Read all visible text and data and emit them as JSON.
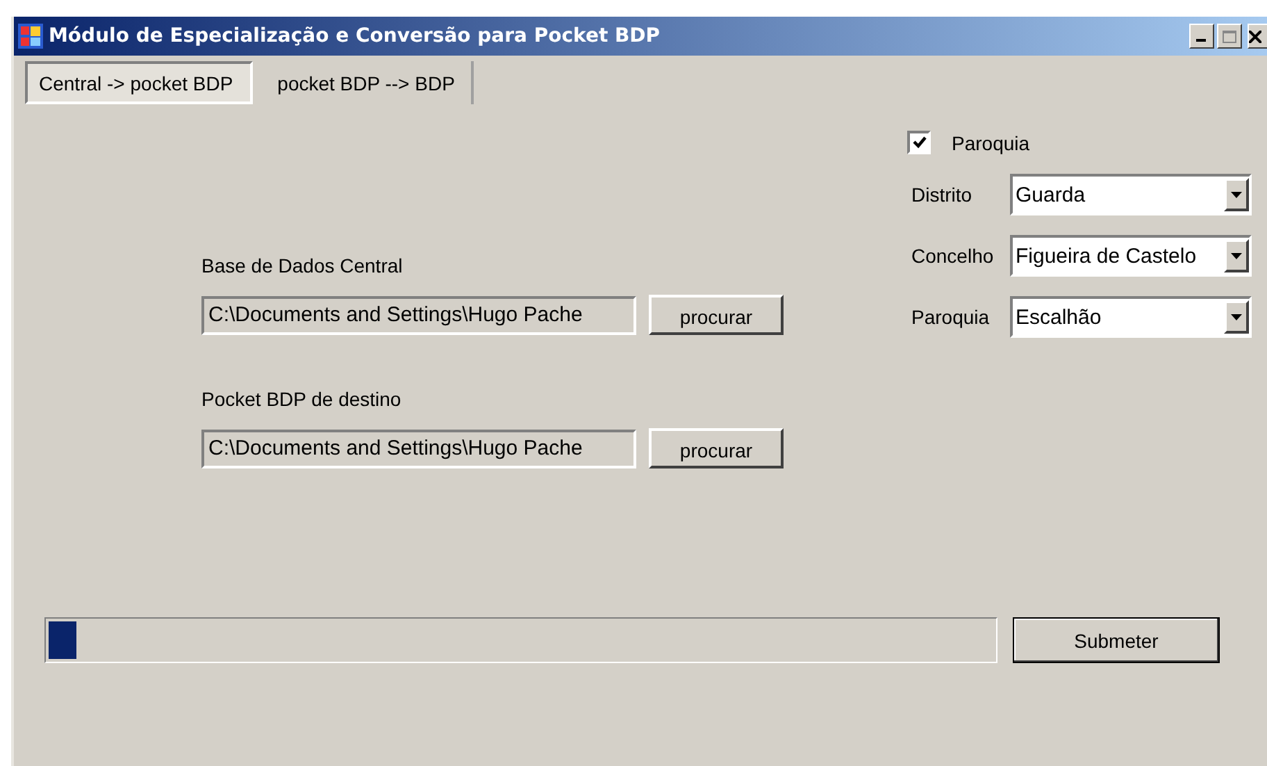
{
  "window": {
    "title": "Módulo de Especialização e Conversão para Pocket BDP"
  },
  "tabs": [
    {
      "label": "Central -> pocket BDP",
      "selected": true
    },
    {
      "label": "pocket BDP --> BDP",
      "selected": false
    }
  ],
  "files": [
    {
      "label": "Base de Dados Central",
      "value": "C:\\Documents and Settings\\Hugo Pache",
      "button": "procurar"
    },
    {
      "label": "Pocket BDP de destino",
      "value": "C:\\Documents and Settings\\Hugo Pache",
      "button": "procurar"
    }
  ],
  "filter": {
    "checkbox": {
      "label": "Paroquia",
      "checked": true
    },
    "combos": [
      {
        "label": "Distrito",
        "value": "Guarda"
      },
      {
        "label": "Concelho",
        "value": "Figueira de Castelo"
      },
      {
        "label": "Paroquia",
        "value": "Escalhão"
      }
    ]
  },
  "progress": {
    "level": 0.03
  },
  "submit_button": "Submeter"
}
